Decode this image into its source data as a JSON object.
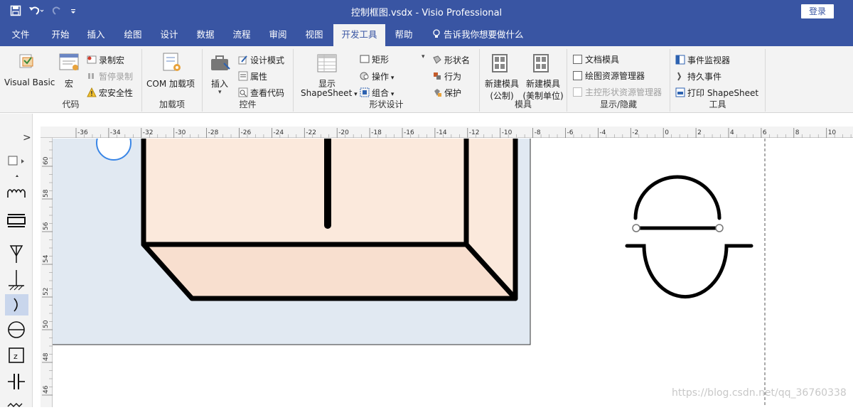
{
  "window": {
    "title": "控制框图.vsdx  -  Visio Professional",
    "login": "登录"
  },
  "tabs": [
    {
      "label": "文件"
    },
    {
      "label": "开始"
    },
    {
      "label": "插入"
    },
    {
      "label": "绘图"
    },
    {
      "label": "设计"
    },
    {
      "label": "数据"
    },
    {
      "label": "流程"
    },
    {
      "label": "审阅"
    },
    {
      "label": "视图"
    },
    {
      "label": "开发工具",
      "active": true
    },
    {
      "label": "帮助"
    }
  ],
  "tell_me": "告诉我你想要做什么",
  "ribbon": {
    "code": {
      "label": "代码",
      "visual_basic": "Visual Basic",
      "macro": "宏",
      "record_macro": "录制宏",
      "pause_record": "暂停录制",
      "macro_security": "宏安全性"
    },
    "addins": {
      "label": "加载项",
      "com_addins": "COM 加载项"
    },
    "controls": {
      "label": "控件",
      "insert": "插入",
      "design_mode": "设计模式",
      "properties": "属性",
      "view_code": "查看代码"
    },
    "shape_design": {
      "label": "形状设计",
      "show": "显示",
      "shapesheet": "ShapeSheet",
      "rectangle": "矩形",
      "operations": "操作",
      "group": "组合",
      "shape_name": "形状名",
      "behavior": "行为",
      "protect": "保护"
    },
    "stencil": {
      "label": "模具",
      "new_metric_1": "新建模具",
      "new_metric_2": "(公制)",
      "new_us_1": "新建模具",
      "new_us_2": "(美制单位)"
    },
    "show_hide": {
      "label": "显示/隐藏",
      "doc_stencil": "文档模具",
      "drawing_explorer": "绘图资源管理器",
      "master_explorer": "主控形状资源管理器"
    },
    "tools": {
      "label": "工具",
      "event_monitor": "事件监视器",
      "persist_events": "持久事件",
      "print_shapesheet": "打印 ShapeSheet"
    }
  },
  "rulers": {
    "h_ticks": [
      "-36",
      "-34",
      "-32",
      "-30",
      "-28",
      "-26",
      "-24",
      "-22",
      "-20",
      "-18",
      "-16",
      "-14",
      "-12",
      "-10",
      "-8",
      "-6",
      "-4",
      "-2",
      "0",
      "2",
      "4",
      "6",
      "8",
      "10"
    ],
    "v_ticks": [
      "60",
      "58",
      "56",
      "54",
      "52",
      "50",
      "48",
      "46"
    ]
  },
  "stencil_panel": {
    "expand": ">"
  },
  "watermark": "https://blog.csdn.net/qq_36760338",
  "colors": {
    "accent": "#3955a3",
    "shape_fill": "#fbe9dc",
    "page_bg": "#e1e9f2",
    "ribbon_bg": "#f3f3f3"
  }
}
